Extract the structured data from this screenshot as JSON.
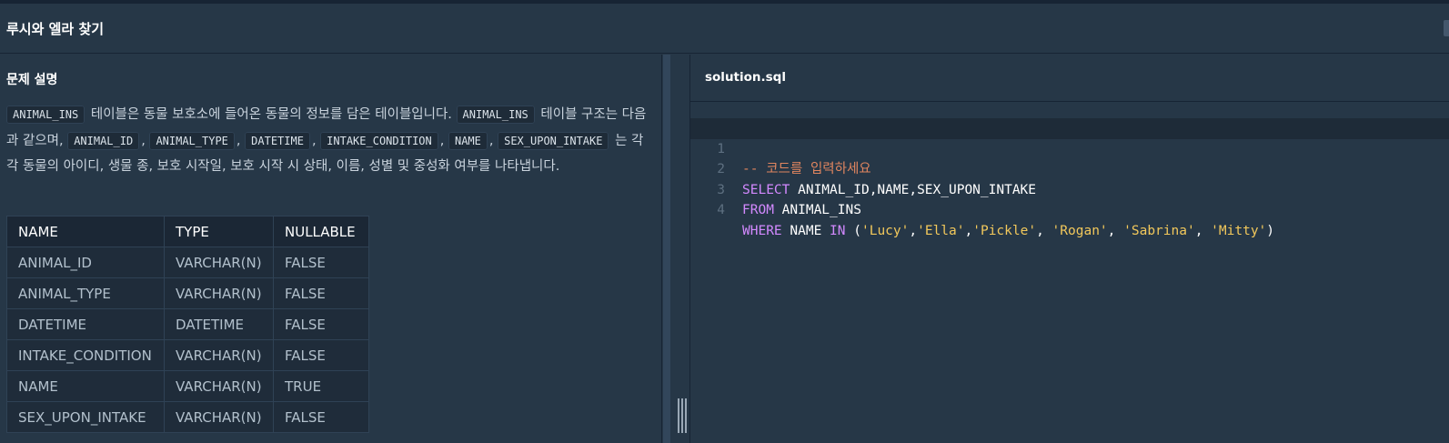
{
  "page": {
    "title": "루시와 엘라 찾기"
  },
  "problem": {
    "section_title": "문제 설명",
    "description": {
      "chip1": "ANIMAL_INS",
      "text1": " 테이블은 동물 보호소에 들어온 동물의 정보를 담은 테이블입니다. ",
      "chip2": "ANIMAL_INS",
      "text2": " 테이블 구조는 다음과 같으며, ",
      "chip3": "ANIMAL_ID",
      "sep3": ", ",
      "chip4": "ANIMAL_TYPE",
      "sep4": ", ",
      "chip5": "DATETIME",
      "sep5": ", ",
      "chip6": "INTAKE_CONDITION",
      "sep6": ", ",
      "chip7": "NAME",
      "sep7": ", ",
      "chip8": "SEX_UPON_INTAKE",
      "text3": " 는 각각 동물의 아이디, 생물 종, 보호 시작일, 보호 시작 시 상태, 이름, 성별 및 중성화 여부를 나타냅니다."
    },
    "table": {
      "headers": [
        "NAME",
        "TYPE",
        "NULLABLE"
      ],
      "rows": [
        [
          "ANIMAL_ID",
          "VARCHAR(N)",
          "FALSE"
        ],
        [
          "ANIMAL_TYPE",
          "VARCHAR(N)",
          "FALSE"
        ],
        [
          "DATETIME",
          "DATETIME",
          "FALSE"
        ],
        [
          "INTAKE_CONDITION",
          "VARCHAR(N)",
          "FALSE"
        ],
        [
          "NAME",
          "VARCHAR(N)",
          "TRUE"
        ],
        [
          "SEX_UPON_INTAKE",
          "VARCHAR(N)",
          "FALSE"
        ]
      ]
    }
  },
  "editor": {
    "filename": "solution.sql",
    "line_numbers": [
      "1",
      "2",
      "3",
      "4"
    ],
    "line1": {
      "comment": "-- 코드를 입력하세요"
    },
    "line2": {
      "kw": "SELECT",
      "rest": " ANIMAL_ID,NAME,SEX_UPON_INTAKE"
    },
    "line3": {
      "kw": "FROM",
      "rest": " ANIMAL_INS"
    },
    "line4": {
      "kw1": "WHERE",
      "p1": " NAME ",
      "kw2": "IN",
      "p2": " (",
      "s1": "'Lucy'",
      "c1": ",",
      "s2": "'Ella'",
      "c2": ",",
      "s3": "'Pickle'",
      "c3": ", ",
      "s4": "'Rogan'",
      "c4": ", ",
      "s5": "'Sabrina'",
      "c5": ", ",
      "s6": "'Mitty'",
      "p3": ")"
    }
  },
  "colors": {
    "background": "#263747",
    "keyword": "#d389ff",
    "string": "#f2c85b",
    "comment": "#e0855f"
  }
}
